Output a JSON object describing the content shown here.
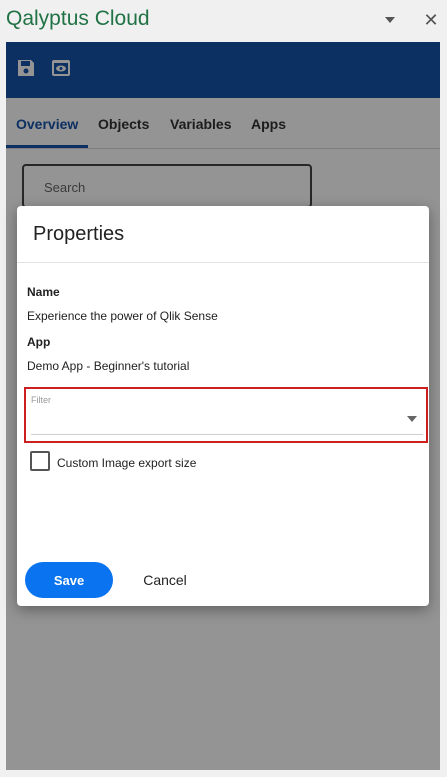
{
  "window": {
    "title": "Qalyptus Cloud",
    "title_color": "#217346",
    "caret_icon": "caret-down-icon",
    "close_icon": "close-icon",
    "close_glyph": "✕"
  },
  "toolbar": {
    "background": "#1553a7",
    "icons": [
      "save-icon",
      "preview-icon"
    ]
  },
  "tabs": [
    {
      "label": "Overview",
      "active": true
    },
    {
      "label": "Objects",
      "active": false
    },
    {
      "label": "Variables",
      "active": false
    },
    {
      "label": "Apps",
      "active": false
    }
  ],
  "search": {
    "placeholder": "Search"
  },
  "dialog": {
    "title": "Properties",
    "name_label": "Name",
    "name_value": "Experience the power of Qlik Sense",
    "app_label": "App",
    "app_value": "Demo App - Beginner's tutorial",
    "filter_label": "Filter",
    "filter_value": "",
    "checkbox_label": "Custom Image export size",
    "checkbox_checked": false,
    "save_label": "Save",
    "cancel_label": "Cancel",
    "accent": "#0a73f0",
    "highlight": "#cc1f1f"
  }
}
